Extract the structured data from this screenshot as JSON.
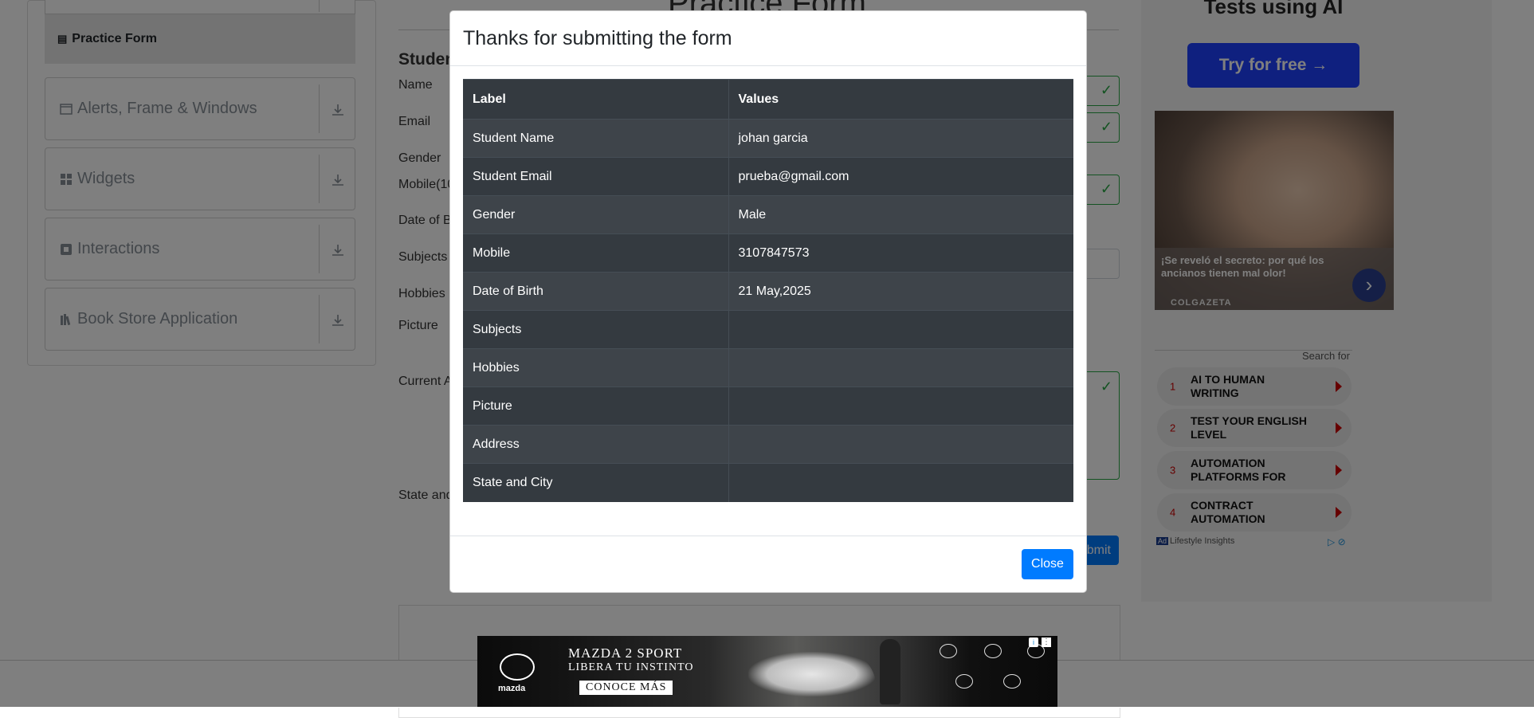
{
  "sidebar": {
    "active_item": "Practice Form",
    "groups": [
      {
        "label": "Alerts, Frame & Windows"
      },
      {
        "label": "Widgets"
      },
      {
        "label": "Interactions"
      },
      {
        "label": "Book Store Application"
      }
    ]
  },
  "form": {
    "title": "Practice Form",
    "section_title": "Studen",
    "labels": {
      "name": "Name",
      "email": "Email",
      "gender": "Gender",
      "mobile": "Mobile(10",
      "dob": "Date of B",
      "subjects": "Subjects",
      "hobbies": "Hobbies",
      "picture": "Picture",
      "address": "Current A",
      "state": "State and"
    },
    "submit_label": "Submit"
  },
  "ad_sidebar": {
    "heading": "Tests using AI",
    "try_button": "Try for free →",
    "photo_caption": "¡Se reveló el secreto: por qué los ancianos tienen mal olor!",
    "photo_source": "COLGAZETA",
    "search_for": "Search for",
    "search_items": [
      {
        "num": "1",
        "label": "AI TO HUMAN WRITING"
      },
      {
        "num": "2",
        "label": "TEST YOUR ENGLISH LEVEL"
      },
      {
        "num": "3",
        "label": "AUTOMATION PLATFORMS FOR"
      },
      {
        "num": "4",
        "label": "CONTRACT AUTOMATION"
      }
    ],
    "footer_badge": "Ad",
    "footer_text": "Lifestyle Insights"
  },
  "modal": {
    "title": "Thanks for submitting the form",
    "headers": {
      "label": "Label",
      "values": "Values"
    },
    "rows": [
      {
        "label": "Student Name",
        "value": "johan garcia"
      },
      {
        "label": "Student Email",
        "value": "prueba@gmail.com"
      },
      {
        "label": "Gender",
        "value": "Male"
      },
      {
        "label": "Mobile",
        "value": "3107847573"
      },
      {
        "label": "Date of Birth",
        "value": "21 May,2025"
      },
      {
        "label": "Subjects",
        "value": ""
      },
      {
        "label": "Hobbies",
        "value": ""
      },
      {
        "label": "Picture",
        "value": ""
      },
      {
        "label": "Address",
        "value": ""
      },
      {
        "label": "State and City",
        "value": ""
      }
    ],
    "close_label": "Close"
  },
  "banner_ad": {
    "brand": "mazda",
    "line1": "MAZDA 2 SPORT",
    "line2": "LIBERA TU INSTINTO",
    "cta": "CONOCE MÁS"
  },
  "colors": {
    "primary": "#007bff",
    "success": "#28a745",
    "table_dark": "#343a40",
    "table_stripe": "#3e444a"
  }
}
